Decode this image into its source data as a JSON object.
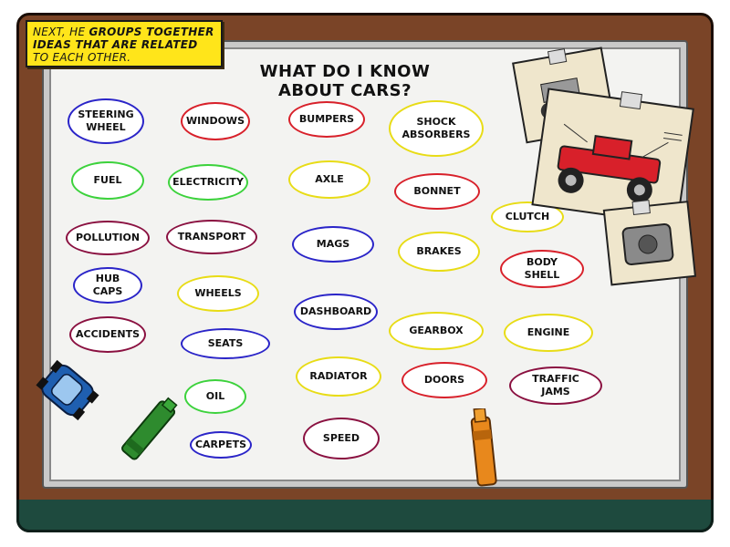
{
  "caption": {
    "part1": "NEXT, HE ",
    "bold1": "GROUPS TOGETHER IDEAS THAT ARE RELATED",
    "part2": " TO EACH OTHER."
  },
  "title": "WHAT DO I KNOW ABOUT CARS?",
  "colors": {
    "blue": "#2a24c8",
    "red": "#d8202a",
    "green": "#3cd23c",
    "yellow": "#e8dc16",
    "maroon": "#8a1040",
    "caption_bg": "#ffe51a",
    "frame": "#7a4427"
  },
  "bubbles": [
    {
      "id": "steering-wheel",
      "label": "STEERING WHEEL"
    },
    {
      "id": "windows",
      "label": "WINDOWS"
    },
    {
      "id": "bumpers",
      "label": "BUMPERS"
    },
    {
      "id": "shock-absorbers",
      "label": "SHOCK ABSORBERS"
    },
    {
      "id": "fuel",
      "label": "FUEL"
    },
    {
      "id": "electricity",
      "label": "ELECTRICITY"
    },
    {
      "id": "axle",
      "label": "AXLE"
    },
    {
      "id": "bonnet",
      "label": "BONNET"
    },
    {
      "id": "clutch",
      "label": "CLUTCH"
    },
    {
      "id": "pollution",
      "label": "POLLUTION"
    },
    {
      "id": "transport",
      "label": "TRANSPORT"
    },
    {
      "id": "mags",
      "label": "MAGS"
    },
    {
      "id": "brakes",
      "label": "BRAKES"
    },
    {
      "id": "body-shell",
      "label": "BODY SHELL"
    },
    {
      "id": "hub-caps",
      "label": "HUB CAPS"
    },
    {
      "id": "wheels",
      "label": "WHEELS"
    },
    {
      "id": "dashboard",
      "label": "DASHBOARD"
    },
    {
      "id": "accidents",
      "label": "ACCIDENTS"
    },
    {
      "id": "seats",
      "label": "SEATS"
    },
    {
      "id": "gearbox",
      "label": "GEARBOX"
    },
    {
      "id": "engine",
      "label": "ENGINE"
    },
    {
      "id": "radiator",
      "label": "RADIATOR"
    },
    {
      "id": "doors",
      "label": "DOORS"
    },
    {
      "id": "traffic-jams",
      "label": "TRAFFIC JAMS"
    },
    {
      "id": "oil",
      "label": "OIL"
    },
    {
      "id": "speed",
      "label": "SPEED"
    },
    {
      "id": "carpets",
      "label": "CARPETS"
    }
  ],
  "icons": [
    "toy-car-icon",
    "green-marker-icon",
    "orange-marker-icon",
    "pinned-car-diagram-icon"
  ]
}
